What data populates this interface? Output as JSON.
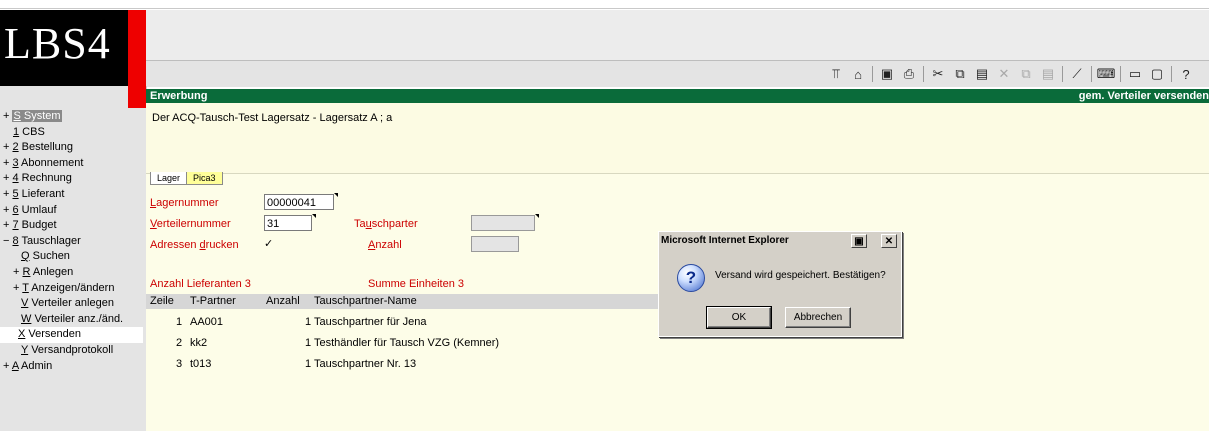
{
  "app": {
    "logo_text": "LBS4"
  },
  "toolbar": {
    "icons": [
      {
        "name": "pin-icon",
        "glyph": "⫪",
        "disabled": false
      },
      {
        "name": "home-icon",
        "glyph": "⌂",
        "disabled": false
      },
      {
        "name": "save-icon",
        "glyph": "▣",
        "disabled": false
      },
      {
        "name": "print-icon",
        "glyph": "⎙",
        "disabled": false
      },
      {
        "name": "cut-icon",
        "glyph": "✂",
        "disabled": false
      },
      {
        "name": "copy-icon",
        "glyph": "⧉",
        "disabled": false
      },
      {
        "name": "paste-icon",
        "glyph": "▤",
        "disabled": false
      },
      {
        "name": "delete-icon",
        "glyph": "✕",
        "disabled": true
      },
      {
        "name": "copy-record-icon",
        "glyph": "⧉",
        "disabled": true
      },
      {
        "name": "paste-record-icon",
        "glyph": "▤",
        "disabled": true
      },
      {
        "name": "edit-icon",
        "glyph": "⟋",
        "disabled": false
      },
      {
        "name": "keyboard-icon",
        "glyph": "⌨",
        "disabled": false
      },
      {
        "name": "minimize-icon",
        "glyph": "▭",
        "disabled": false
      },
      {
        "name": "window-icon",
        "glyph": "▢",
        "disabled": false
      },
      {
        "name": "help-icon",
        "glyph": "?",
        "disabled": false
      }
    ]
  },
  "sidebar": {
    "items": [
      {
        "prefix": "+ ",
        "key": "S",
        "rest": " System",
        "selected": true
      },
      {
        "prefix": "",
        "key": "1",
        "rest": " CBS"
      },
      {
        "prefix": "+ ",
        "key": "2",
        "rest": " Bestellung"
      },
      {
        "prefix": "+ ",
        "key": "3",
        "rest": " Abonnement"
      },
      {
        "prefix": "+ ",
        "key": "4",
        "rest": " Rechnung"
      },
      {
        "prefix": "+ ",
        "key": "5",
        "rest": " Lieferant"
      },
      {
        "prefix": "+ ",
        "key": "6",
        "rest": " Umlauf"
      },
      {
        "prefix": "+ ",
        "key": "7",
        "rest": " Budget"
      },
      {
        "prefix": "− ",
        "key": "8",
        "rest": " Tauschlager"
      },
      {
        "prefix": "",
        "key": "Q",
        "rest": " Suchen"
      },
      {
        "prefix": "+ ",
        "key": "R",
        "rest": " Anlegen"
      },
      {
        "prefix": "+ ",
        "key": "T",
        "rest": " Anzeigen/ändern"
      },
      {
        "prefix": "",
        "key": "V",
        "rest": " Verteiler anlegen"
      },
      {
        "prefix": "",
        "key": "W",
        "rest": " Verteiler anz./änd."
      },
      {
        "prefix": "",
        "key": "X",
        "rest": " Versenden",
        "active": true
      },
      {
        "prefix": "",
        "key": "Y",
        "rest": " Versandprotokoll"
      },
      {
        "prefix": "+ ",
        "key": "A",
        "rest": " Admin"
      }
    ]
  },
  "titlebar": {
    "left": "Erwerbung",
    "right": "gem. Verteiler versenden"
  },
  "info": {
    "text": "Der ACQ-Tausch-Test Lagersatz - Lagersatz A ; a"
  },
  "tabs": [
    "Lager",
    "Pica3"
  ],
  "form": {
    "lagernummer_label_key": "L",
    "lagernummer_label_rest": "agernummer",
    "lagernummer_value": "00000041",
    "verteiler_label_key": "V",
    "verteiler_label_rest": "erteilernummer",
    "verteiler_value": "31",
    "adressen_label_pre": "Adressen ",
    "adressen_label_key": "d",
    "adressen_label_rest": "rucken",
    "adressen_checked": "✓",
    "tauschpartner_label_pre": "Ta",
    "tauschpartner_label_key": "u",
    "tauschpartner_label_rest": "schparter",
    "anzahl_label_key": "A",
    "anzahl_label_rest": "nzahl",
    "anzahl_lieferanten": "Anzahl Lieferanten 3",
    "summe_einheiten": "Summe Einheiten 3"
  },
  "table": {
    "headers": [
      "Zeile",
      "T-Partner",
      "Anzahl",
      "Tauschpartner-Name"
    ],
    "rows": [
      {
        "zeile": "1",
        "partner": "AA001",
        "anzahl": "1",
        "name": "Tauschpartner für Jena"
      },
      {
        "zeile": "2",
        "partner": "kk2",
        "anzahl": "1",
        "name": "Testhändler für Tausch VZG (Kemner)"
      },
      {
        "zeile": "3",
        "partner": "t013",
        "anzahl": "1",
        "name": "Tauschpartner Nr. 13"
      }
    ]
  },
  "dialog": {
    "title": "Microsoft Internet Explorer",
    "message": "Versand wird gespeichert. Bestätigen?",
    "ok": "OK",
    "cancel": "Abbrechen"
  }
}
